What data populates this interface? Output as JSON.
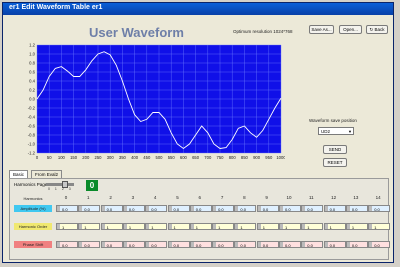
{
  "window": {
    "title": "er1 Edit Waveform Table er1"
  },
  "header": {
    "waveform_title": "User Waveform",
    "resolution_note": "Optimum resolution 1024*768",
    "save_as_label": "Save As...",
    "open_label": "Open...",
    "back_label": "Back"
  },
  "side": {
    "save_position_label": "Waveform save position",
    "save_position_value": "UD2",
    "send_label": "SEND",
    "reset_label": "RESET"
  },
  "tabs": [
    "Basic",
    "From Eval2"
  ],
  "harmonics": {
    "page_label": "Harmonics Page",
    "page_value": "0",
    "page_ticks": "0 1 2 3",
    "row_labels": {
      "harmonics": "Harmonics",
      "amplitude": "Amplitude (%)",
      "order": "Harmonic Order",
      "phase": "Phase Shift"
    },
    "columns": [
      {
        "n": "0",
        "amp": "0.0",
        "order": "1",
        "phase": "0.0"
      },
      {
        "n": "1",
        "amp": "0.0",
        "order": "1",
        "phase": "0.0"
      },
      {
        "n": "2",
        "amp": "0.0",
        "order": "1",
        "phase": "0.0"
      },
      {
        "n": "3",
        "amp": "0.0",
        "order": "1",
        "phase": "0.0"
      },
      {
        "n": "4",
        "amp": "0.0",
        "order": "1",
        "phase": "0.0"
      },
      {
        "n": "5",
        "amp": "0.0",
        "order": "1",
        "phase": "0.0"
      },
      {
        "n": "6",
        "amp": "0.0",
        "order": "1",
        "phase": "0.0"
      },
      {
        "n": "7",
        "amp": "0.0",
        "order": "1",
        "phase": "0.0"
      },
      {
        "n": "8",
        "amp": "0.0",
        "order": "1",
        "phase": "0.0"
      },
      {
        "n": "9",
        "amp": "0.0",
        "order": "1",
        "phase": "0.0"
      },
      {
        "n": "10",
        "amp": "0.0",
        "order": "1",
        "phase": "0.0"
      },
      {
        "n": "11",
        "amp": "0.0",
        "order": "1",
        "phase": "0.0"
      },
      {
        "n": "12",
        "amp": "0.0",
        "order": "1",
        "phase": "0.0"
      },
      {
        "n": "13",
        "amp": "0.0",
        "order": "1",
        "phase": "0.0"
      },
      {
        "n": "14",
        "amp": "0.0",
        "order": "1",
        "phase": "0.0"
      }
    ]
  },
  "colors": {
    "plot_bg": "#1010e8",
    "line": "#ffffff",
    "grid": "#6a7aff"
  },
  "chart_data": {
    "type": "line",
    "title": "User Waveform",
    "xlim": [
      0,
      1000
    ],
    "ylim": [
      -1.2,
      1.2
    ],
    "x_ticks": [
      0,
      50,
      100,
      150,
      200,
      250,
      300,
      350,
      400,
      450,
      500,
      550,
      600,
      650,
      700,
      750,
      800,
      850,
      900,
      950,
      1000
    ],
    "y_ticks": [
      1.2,
      1.0,
      0.8,
      0.6,
      0.4,
      0.2,
      0.0,
      -0.2,
      -0.4,
      -0.6,
      -0.8,
      -1.0,
      -1.2
    ],
    "grid": true,
    "series": [
      {
        "x": [
          0,
          25,
          50,
          75,
          100,
          125,
          150,
          175,
          200,
          225,
          250,
          275,
          300,
          325,
          350,
          375,
          400,
          425,
          450,
          475,
          500,
          525,
          550,
          575,
          600,
          625,
          650,
          675,
          700,
          725,
          750,
          775,
          800,
          825,
          850,
          875,
          900,
          925,
          950,
          975,
          1000
        ],
        "y": [
          0.0,
          0.2,
          0.5,
          0.68,
          0.72,
          0.62,
          0.5,
          0.5,
          0.65,
          0.85,
          1.0,
          1.05,
          0.98,
          0.75,
          0.4,
          0.0,
          -0.35,
          -0.5,
          -0.45,
          -0.3,
          -0.3,
          -0.45,
          -0.75,
          -1.0,
          -1.1,
          -1.0,
          -0.8,
          -0.6,
          -0.75,
          -1.0,
          -1.1,
          -1.08,
          -0.9,
          -0.65,
          -0.6,
          -0.75,
          -0.85,
          -0.7,
          -0.45,
          -0.2,
          0.02
        ]
      }
    ]
  }
}
